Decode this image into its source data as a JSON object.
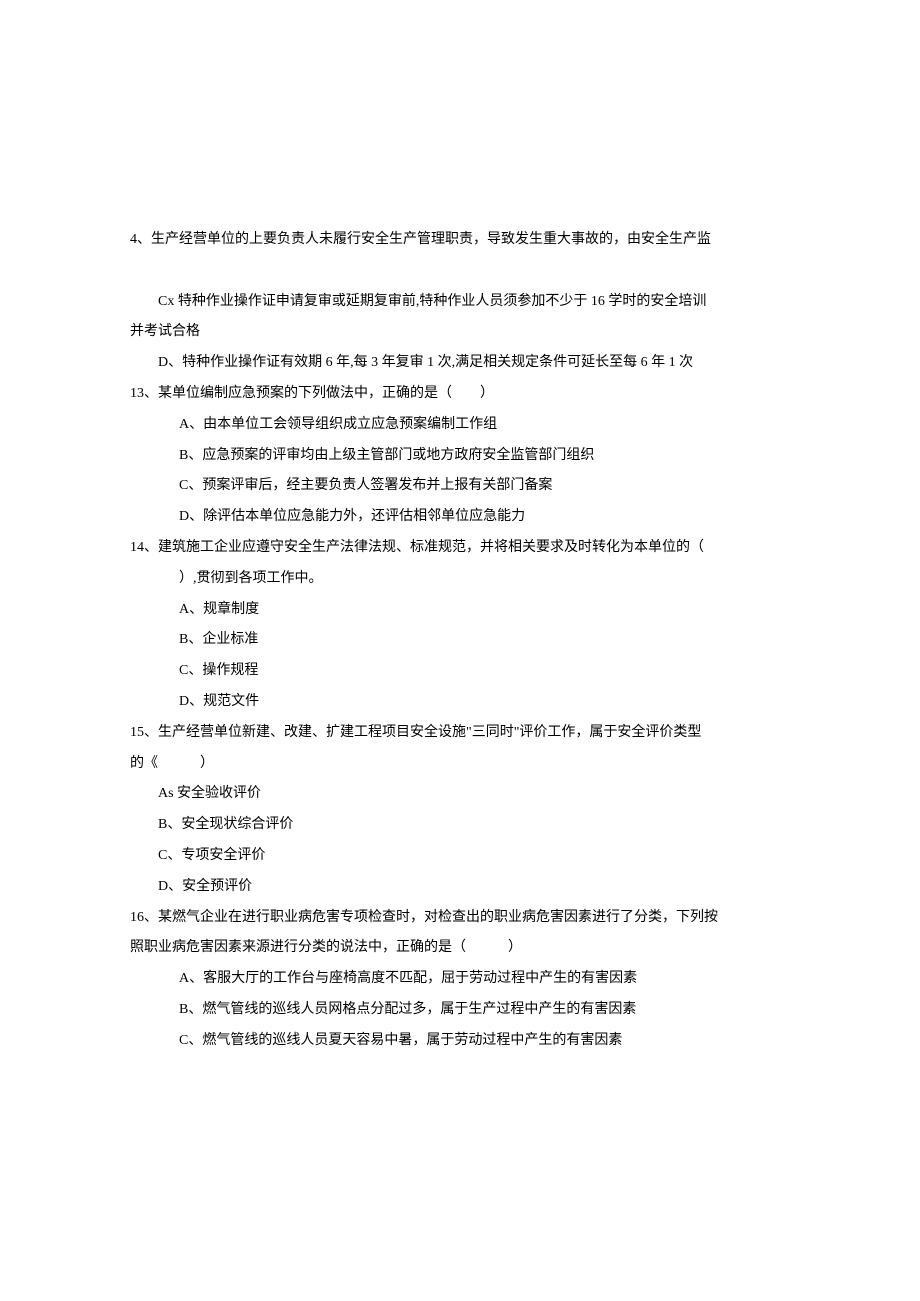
{
  "lines": [
    {
      "cls": "no-indent",
      "text": "4、生产经营单位的上要负责人未履行安全生产管理职责，导致发生重大事故的，由安全生产监"
    },
    {
      "cls": "spacer",
      "text": ""
    },
    {
      "cls": "indent-1",
      "text": "Cx 特种作业操作证申请复审或延期复审前,特种作业人员须参加不少于 16 学时的安全培训"
    },
    {
      "cls": "no-indent",
      "text": "并考试合格"
    },
    {
      "cls": "indent-1",
      "text": "D、特种作业操作证有效期 6 年,每 3 年复审 1 次,满足相关规定条件可延长至每 6 年 1 次"
    },
    {
      "cls": "no-indent",
      "text": "13、某单位编制应急预案的下列做法中，正确的是（　　）"
    },
    {
      "cls": "indent-2",
      "text": "A、由本单位工会领导组织成立应急预案编制工作组"
    },
    {
      "cls": "indent-2",
      "text": "B、应急预案的评审均由上级主管部门或地方政府安全监管部门组织"
    },
    {
      "cls": "indent-2",
      "text": "C、预案评审后，经主要负责人签署发布并上报有关部门备案"
    },
    {
      "cls": "indent-2",
      "text": "D、除评估本单位应急能力外，还评估相邻单位应急能力"
    },
    {
      "cls": "no-indent",
      "text": "14、建筑施工企业应遵守安全生产法律法规、标准规范，并将相关要求及时转化为本单位的（"
    },
    {
      "cls": "indent-2",
      "text": "）,贯彻到各项工作中。"
    },
    {
      "cls": "indent-2",
      "text": "A、规章制度"
    },
    {
      "cls": "indent-2",
      "text": "B、企业标准"
    },
    {
      "cls": "indent-2",
      "text": "C、操作规程"
    },
    {
      "cls": "indent-2",
      "text": "D、规范文件"
    },
    {
      "cls": "no-indent",
      "text": "15、生产经营单位新建、改建、扩建工程项目安全设施\"三同时\"评价工作，属于安全评价类型"
    },
    {
      "cls": "no-indent",
      "text": "的《　　　）"
    },
    {
      "cls": "indent-1",
      "text": "As 安全验收评价"
    },
    {
      "cls": "indent-1",
      "text": "B、安全现状综合评价"
    },
    {
      "cls": "indent-1",
      "text": "C、专项安全评价"
    },
    {
      "cls": "indent-1",
      "text": "D、安全预评价"
    },
    {
      "cls": "no-indent",
      "text": "16、某燃气企业在进行职业病危害专项检查时，对检查出的职业病危害因素进行了分类，下列按"
    },
    {
      "cls": "no-indent",
      "text": "照职业病危害因素来源进行分类的说法中，正确的是（　　　）"
    },
    {
      "cls": "indent-2",
      "text": "A、客服大厅的工作台与座椅高度不匹配，屈于劳动过程中产生的有害因素"
    },
    {
      "cls": "indent-2",
      "text": "B、燃气管线的巡线人员网格点分配过多，属于生产过程中产生的有害因素"
    },
    {
      "cls": "indent-2",
      "text": "C、燃气管线的巡线人员夏天容易中暑，属于劳动过程中产生的有害因素"
    }
  ]
}
